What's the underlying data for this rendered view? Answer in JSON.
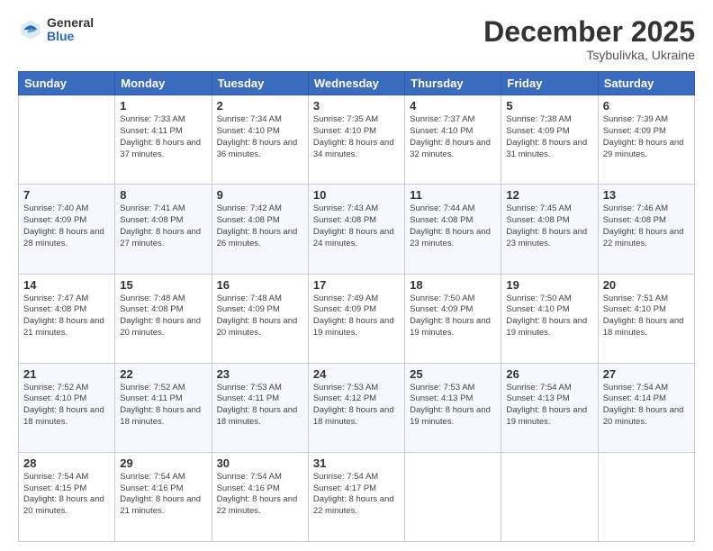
{
  "logo": {
    "general": "General",
    "blue": "Blue"
  },
  "header": {
    "month": "December 2025",
    "location": "Tsybulivka, Ukraine"
  },
  "weekdays": [
    "Sunday",
    "Monday",
    "Tuesday",
    "Wednesday",
    "Thursday",
    "Friday",
    "Saturday"
  ],
  "weeks": [
    [
      {
        "day": "",
        "sunrise": "",
        "sunset": "",
        "daylight": ""
      },
      {
        "day": "1",
        "sunrise": "Sunrise: 7:33 AM",
        "sunset": "Sunset: 4:11 PM",
        "daylight": "Daylight: 8 hours and 37 minutes."
      },
      {
        "day": "2",
        "sunrise": "Sunrise: 7:34 AM",
        "sunset": "Sunset: 4:10 PM",
        "daylight": "Daylight: 8 hours and 36 minutes."
      },
      {
        "day": "3",
        "sunrise": "Sunrise: 7:35 AM",
        "sunset": "Sunset: 4:10 PM",
        "daylight": "Daylight: 8 hours and 34 minutes."
      },
      {
        "day": "4",
        "sunrise": "Sunrise: 7:37 AM",
        "sunset": "Sunset: 4:10 PM",
        "daylight": "Daylight: 8 hours and 32 minutes."
      },
      {
        "day": "5",
        "sunrise": "Sunrise: 7:38 AM",
        "sunset": "Sunset: 4:09 PM",
        "daylight": "Daylight: 8 hours and 31 minutes."
      },
      {
        "day": "6",
        "sunrise": "Sunrise: 7:39 AM",
        "sunset": "Sunset: 4:09 PM",
        "daylight": "Daylight: 8 hours and 29 minutes."
      }
    ],
    [
      {
        "day": "7",
        "sunrise": "Sunrise: 7:40 AM",
        "sunset": "Sunset: 4:09 PM",
        "daylight": "Daylight: 8 hours and 28 minutes."
      },
      {
        "day": "8",
        "sunrise": "Sunrise: 7:41 AM",
        "sunset": "Sunset: 4:08 PM",
        "daylight": "Daylight: 8 hours and 27 minutes."
      },
      {
        "day": "9",
        "sunrise": "Sunrise: 7:42 AM",
        "sunset": "Sunset: 4:08 PM",
        "daylight": "Daylight: 8 hours and 26 minutes."
      },
      {
        "day": "10",
        "sunrise": "Sunrise: 7:43 AM",
        "sunset": "Sunset: 4:08 PM",
        "daylight": "Daylight: 8 hours and 24 minutes."
      },
      {
        "day": "11",
        "sunrise": "Sunrise: 7:44 AM",
        "sunset": "Sunset: 4:08 PM",
        "daylight": "Daylight: 8 hours and 23 minutes."
      },
      {
        "day": "12",
        "sunrise": "Sunrise: 7:45 AM",
        "sunset": "Sunset: 4:08 PM",
        "daylight": "Daylight: 8 hours and 23 minutes."
      },
      {
        "day": "13",
        "sunrise": "Sunrise: 7:46 AM",
        "sunset": "Sunset: 4:08 PM",
        "daylight": "Daylight: 8 hours and 22 minutes."
      }
    ],
    [
      {
        "day": "14",
        "sunrise": "Sunrise: 7:47 AM",
        "sunset": "Sunset: 4:08 PM",
        "daylight": "Daylight: 8 hours and 21 minutes."
      },
      {
        "day": "15",
        "sunrise": "Sunrise: 7:48 AM",
        "sunset": "Sunset: 4:08 PM",
        "daylight": "Daylight: 8 hours and 20 minutes."
      },
      {
        "day": "16",
        "sunrise": "Sunrise: 7:48 AM",
        "sunset": "Sunset: 4:09 PM",
        "daylight": "Daylight: 8 hours and 20 minutes."
      },
      {
        "day": "17",
        "sunrise": "Sunrise: 7:49 AM",
        "sunset": "Sunset: 4:09 PM",
        "daylight": "Daylight: 8 hours and 19 minutes."
      },
      {
        "day": "18",
        "sunrise": "Sunrise: 7:50 AM",
        "sunset": "Sunset: 4:09 PM",
        "daylight": "Daylight: 8 hours and 19 minutes."
      },
      {
        "day": "19",
        "sunrise": "Sunrise: 7:50 AM",
        "sunset": "Sunset: 4:10 PM",
        "daylight": "Daylight: 8 hours and 19 minutes."
      },
      {
        "day": "20",
        "sunrise": "Sunrise: 7:51 AM",
        "sunset": "Sunset: 4:10 PM",
        "daylight": "Daylight: 8 hours and 18 minutes."
      }
    ],
    [
      {
        "day": "21",
        "sunrise": "Sunrise: 7:52 AM",
        "sunset": "Sunset: 4:10 PM",
        "daylight": "Daylight: 8 hours and 18 minutes."
      },
      {
        "day": "22",
        "sunrise": "Sunrise: 7:52 AM",
        "sunset": "Sunset: 4:11 PM",
        "daylight": "Daylight: 8 hours and 18 minutes."
      },
      {
        "day": "23",
        "sunrise": "Sunrise: 7:53 AM",
        "sunset": "Sunset: 4:11 PM",
        "daylight": "Daylight: 8 hours and 18 minutes."
      },
      {
        "day": "24",
        "sunrise": "Sunrise: 7:53 AM",
        "sunset": "Sunset: 4:12 PM",
        "daylight": "Daylight: 8 hours and 18 minutes."
      },
      {
        "day": "25",
        "sunrise": "Sunrise: 7:53 AM",
        "sunset": "Sunset: 4:13 PM",
        "daylight": "Daylight: 8 hours and 19 minutes."
      },
      {
        "day": "26",
        "sunrise": "Sunrise: 7:54 AM",
        "sunset": "Sunset: 4:13 PM",
        "daylight": "Daylight: 8 hours and 19 minutes."
      },
      {
        "day": "27",
        "sunrise": "Sunrise: 7:54 AM",
        "sunset": "Sunset: 4:14 PM",
        "daylight": "Daylight: 8 hours and 20 minutes."
      }
    ],
    [
      {
        "day": "28",
        "sunrise": "Sunrise: 7:54 AM",
        "sunset": "Sunset: 4:15 PM",
        "daylight": "Daylight: 8 hours and 20 minutes."
      },
      {
        "day": "29",
        "sunrise": "Sunrise: 7:54 AM",
        "sunset": "Sunset: 4:16 PM",
        "daylight": "Daylight: 8 hours and 21 minutes."
      },
      {
        "day": "30",
        "sunrise": "Sunrise: 7:54 AM",
        "sunset": "Sunset: 4:16 PM",
        "daylight": "Daylight: 8 hours and 22 minutes."
      },
      {
        "day": "31",
        "sunrise": "Sunrise: 7:54 AM",
        "sunset": "Sunset: 4:17 PM",
        "daylight": "Daylight: 8 hours and 22 minutes."
      },
      {
        "day": "",
        "sunrise": "",
        "sunset": "",
        "daylight": ""
      },
      {
        "day": "",
        "sunrise": "",
        "sunset": "",
        "daylight": ""
      },
      {
        "day": "",
        "sunrise": "",
        "sunset": "",
        "daylight": ""
      }
    ]
  ]
}
